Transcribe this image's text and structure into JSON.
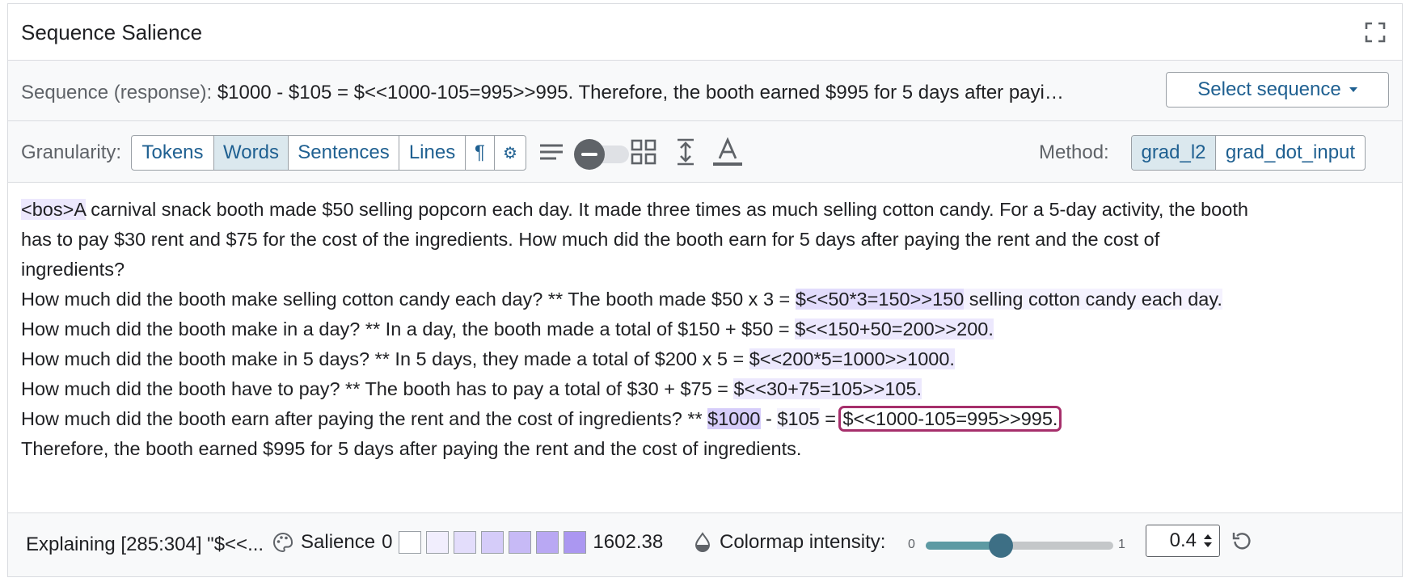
{
  "header": {
    "title": "Sequence Salience"
  },
  "sequence": {
    "label": "Sequence (response):",
    "value": "$1000 - $105 = $<<1000-105=995>>995. Therefore, the booth earned $995 for 5 days after payi…",
    "select_label": "Select sequence"
  },
  "controls": {
    "granularity_label": "Granularity:",
    "granularity": [
      "Tokens",
      "Words",
      "Sentences",
      "Lines",
      "¶",
      "⚙"
    ],
    "granularity_selected": "Words",
    "method_label": "Method:",
    "methods": [
      "grad_l2",
      "grad_dot_input"
    ],
    "method_selected": "grad_l2"
  },
  "text_lines": [
    [
      [
        "<bos>A",
        2
      ],
      [
        " carnival snack booth made $50 selling popcorn each day. It made three times as much selling cotton candy. For a 5-day activity, the booth",
        0
      ]
    ],
    [
      [
        "has to pay $30 rent and $75 for the cost of the ingredients. How much did the booth earn for 5 days after paying the rent and the cost of",
        0
      ]
    ],
    [
      [
        "ingredients?",
        0
      ]
    ],
    [
      [
        "How much did the booth make selling cotton candy each day? ** The booth made $50 x 3 = ",
        0
      ],
      [
        "$<<50*3=150>>150",
        3
      ],
      [
        " selling cotton candy each day.",
        1
      ]
    ],
    [
      [
        "How much did the booth make in a day? ** In a day, the booth made a total of $150 + $50 = ",
        0
      ],
      [
        "$<<150+50=200>>200.",
        2
      ]
    ],
    [
      [
        "How much did the booth make in 5 days? ** In 5 days, they made a total of $200 x 5 = ",
        0
      ],
      [
        "$<<200*5=1000>>1000.",
        2
      ]
    ],
    [
      [
        "How much did the booth have to pay? ** The booth has to pay a total of $30 + $75 = ",
        0
      ],
      [
        "$<<30+75=105>>105.",
        2
      ]
    ],
    [
      [
        "How much did the booth earn after paying the rent and the cost of ingredients? ** ",
        0
      ],
      [
        "$1000",
        4
      ],
      [
        " - ",
        0
      ],
      [
        "$105",
        1
      ],
      [
        " = ",
        0
      ],
      [
        "$<<1000-105=995>>995.",
        -1
      ]
    ],
    [
      [
        "Therefore, the booth earned $995 for 5 days after paying the rent and the cost of ingredients.",
        0
      ]
    ]
  ],
  "footer": {
    "explaining": "Explaining [285:304] \"$<<...",
    "salience_label": "Salience",
    "salience_min": "0",
    "salience_max": "1602.38",
    "salience_swatches": [
      "#ffffff",
      "#f1eefd",
      "#e3ddfb",
      "#d5ccf9",
      "#c7baf6",
      "#b9a8f3",
      "#ab97f1"
    ],
    "colormap_label": "Colormap intensity:",
    "slider_min": "0",
    "slider_max": "1",
    "slider_value_fraction": 0.4,
    "intensity_value": "0.4"
  }
}
